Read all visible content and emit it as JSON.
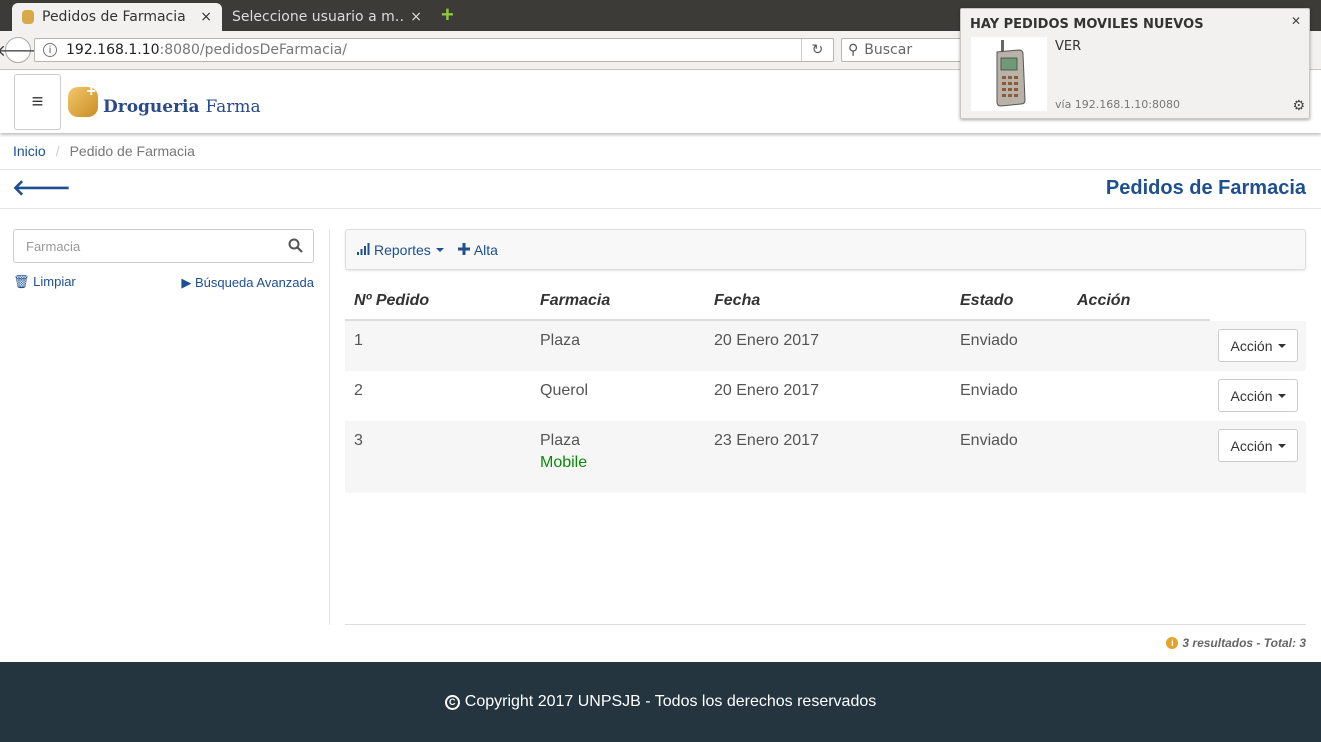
{
  "browser": {
    "tabs": [
      {
        "title": "Pedidos de Farmacia",
        "close": "×"
      },
      {
        "title": "Seleccione usuario a m…",
        "close": "×"
      }
    ],
    "new_tab": "+",
    "url_host": "192.168.1.10",
    "url_rest": ":8080/pedidosDeFarmacia/",
    "search_placeholder": "Buscar"
  },
  "header": {
    "menu_icon": "≡",
    "logo_bold": "Drogueria",
    "logo_light": "Farma"
  },
  "breadcrumb": {
    "home": "Inicio",
    "separator": "/",
    "current": "Pedido de Farmacia"
  },
  "page": {
    "back_icon": "arrow-left-icon",
    "title": "Pedidos de Farmacia"
  },
  "sidebar": {
    "filter_placeholder": "Farmacia",
    "clear_label": "Limpiar",
    "advanced_label": "Búsqueda Avanzada"
  },
  "toolbar": {
    "reports_label": "Reportes",
    "add_label": "Alta"
  },
  "table": {
    "headers": [
      "Nº Pedido",
      "Farmacia",
      "Fecha",
      "Estado",
      "Acción"
    ],
    "rows": [
      {
        "id": "1",
        "farmacia": "Plaza",
        "tag": "",
        "fecha": "20 Enero 2017",
        "estado": "Enviado",
        "action": "Acción"
      },
      {
        "id": "2",
        "farmacia": "Querol",
        "tag": "",
        "fecha": "20 Enero 2017",
        "estado": "Enviado",
        "action": "Acción"
      },
      {
        "id": "3",
        "farmacia": "Plaza",
        "tag": "Mobile",
        "fecha": "23 Enero 2017",
        "estado": "Enviado",
        "action": "Acción"
      }
    ]
  },
  "results": "3 resultados - Total: 3",
  "footer": {
    "text": "Copyright 2017 UNPSJB - Todos los derechos reservados"
  },
  "notification": {
    "title": "HAY PEDIDOS MOVILES NUEVOS",
    "body": "VER",
    "source": "vía 192.168.1.10:8080"
  },
  "colors": {
    "brand_blue": "#1d4f91",
    "footer_bg": "#243540",
    "mobile_green": "#0a8a0a"
  }
}
